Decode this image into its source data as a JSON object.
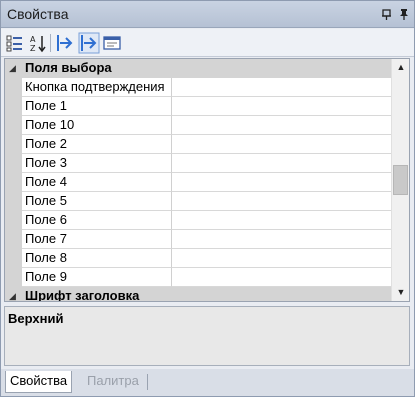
{
  "window": {
    "title": "Свойства",
    "pin_icon": "pin-icon",
    "close_icon": "close-icon"
  },
  "toolbar": {
    "icons": [
      "categorized-view-icon",
      "alphabetical-sort-icon",
      "expand-icon",
      "collapse-icon",
      "property-pages-icon"
    ]
  },
  "grid": {
    "category1": "Поля выбора",
    "properties": [
      {
        "name": "Кнопка подтверждения",
        "value": ""
      },
      {
        "name": "Поле 1",
        "value": ""
      },
      {
        "name": "Поле 10",
        "value": ""
      },
      {
        "name": "Поле 2",
        "value": ""
      },
      {
        "name": "Поле 3",
        "value": ""
      },
      {
        "name": "Поле 4",
        "value": ""
      },
      {
        "name": "Поле 5",
        "value": ""
      },
      {
        "name": "Поле 6",
        "value": ""
      },
      {
        "name": "Поле 7",
        "value": ""
      },
      {
        "name": "Поле 8",
        "value": ""
      },
      {
        "name": "Поле 9",
        "value": ""
      }
    ],
    "category2": "Шрифт заголовка"
  },
  "description": {
    "title": "Верхний"
  },
  "tabs": {
    "active": "Свойства",
    "inactive": "Палитра"
  },
  "colors": {
    "titlebar": "#c0cbdc",
    "category_bg": "#d4d4d4"
  }
}
